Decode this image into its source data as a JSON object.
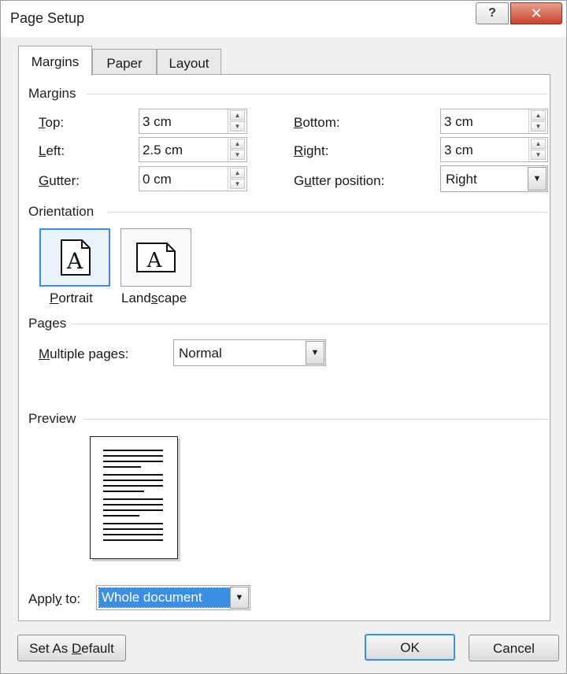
{
  "window": {
    "title": "Page Setup",
    "help_glyph": "?",
    "close_glyph": "✕"
  },
  "tabs": [
    {
      "label": "Margins",
      "active": true
    },
    {
      "label": "Paper",
      "active": false
    },
    {
      "label": "Layout",
      "active": false
    }
  ],
  "margins": {
    "section_title": "Margins",
    "top": {
      "label": "Top:",
      "hotkey": "T",
      "rest": "op:",
      "value": "3 cm"
    },
    "left": {
      "label": "Left:",
      "hotkey": "L",
      "rest": "eft:",
      "value": "2.5 cm"
    },
    "gutter": {
      "label": "Gutter:",
      "hotkey": "G",
      "rest": "utter:",
      "value": "0 cm"
    },
    "bottom": {
      "label": "Bottom:",
      "hotkey": "B",
      "rest": "ottom:",
      "value": "3 cm"
    },
    "right": {
      "label": "Right:",
      "hotkey": "R",
      "rest": "ight:",
      "value": "3 cm"
    },
    "gutter_position": {
      "pre": "G",
      "hotkey": "u",
      "rest": "tter position:",
      "value": "Right"
    }
  },
  "orientation": {
    "section_title": "Orientation",
    "portrait": {
      "pre": "",
      "hotkey": "P",
      "rest": "ortrait",
      "glyph": "A",
      "selected": true
    },
    "landscape": {
      "pre": "Land",
      "hotkey": "s",
      "rest": "cape",
      "glyph": "A",
      "selected": false
    }
  },
  "pages": {
    "section_title": "Pages",
    "multiple_pages": {
      "hotkey": "M",
      "rest": "ultiple pages:",
      "value": "Normal"
    }
  },
  "preview": {
    "section_title": "Preview"
  },
  "apply_to": {
    "pre": "Appl",
    "hotkey": "y",
    "rest": " to:",
    "value": "Whole document"
  },
  "buttons": {
    "set_default": {
      "pre": "Set As ",
      "hotkey": "D",
      "rest": "efault"
    },
    "ok": "OK",
    "cancel": "Cancel"
  },
  "colors": {
    "accent": "#3a8ee6",
    "close": "#c8432b"
  }
}
